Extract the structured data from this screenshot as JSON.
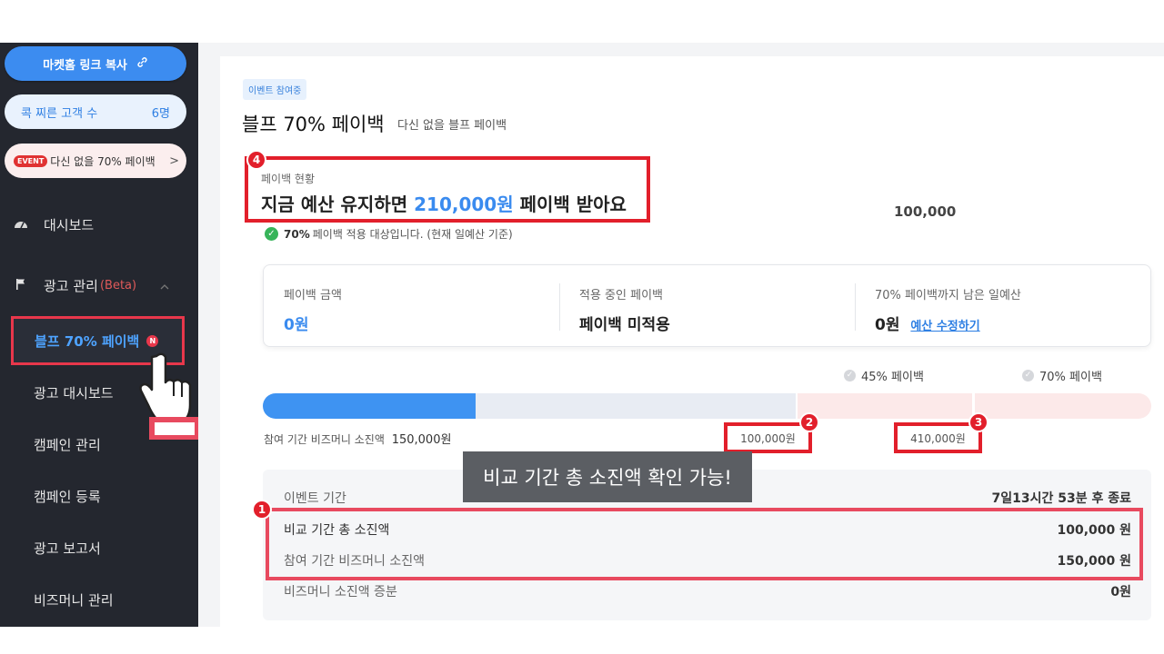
{
  "sidebar": {
    "copy_link_label": "마켓홈 링크 복사",
    "customer_count_label": "콕 찌른 고객 수",
    "customer_count_value": "6명",
    "event_badge": "EVENT",
    "event_label": "다신 없을 70% 페이백",
    "event_chevron": ">",
    "nav_dashboard": "대시보드",
    "nav_ads": "광고 관리",
    "nav_ads_beta": "(Beta)",
    "sub_active": "블프 70% 페이백",
    "sub_active_badge": "N",
    "sub_items": [
      "광고 대시보드",
      "캠페인 관리",
      "캠페인 등록",
      "광고 보고서",
      "비즈머니 관리"
    ]
  },
  "header": {
    "tag": "이벤트 참여중",
    "title": "블프 70% 페이백",
    "subtitle": "다신 없을 블프 페이백"
  },
  "status": {
    "label": "페이백 현황",
    "main_prefix": "지금 예산 유지하면",
    "main_amount": "210,000원",
    "main_suffix": "페이백 받아요",
    "note_bold": "70%",
    "note_rest": "페이백 적용 대상입니다. (현재 일예산 기준)",
    "right_value": "100,000"
  },
  "info": {
    "payback_amount_label": "페이백 금액",
    "payback_amount_value": "0원",
    "applied_label": "적용 중인 페이백",
    "applied_value": "페이백 미적용",
    "remaining_label": "70% 페이백까지 남은 일예산",
    "remaining_value": "0원",
    "edit_link": "예산 수정하기"
  },
  "progress": {
    "milestone_45": "45% 페이백",
    "milestone_70": "70% 페이백",
    "caption_label": "참여 기간 비즈머니 소진액",
    "caption_value": "150,000원",
    "marker_1": "100,000원",
    "marker_2": "410,000원",
    "fill_value": 150000
  },
  "tooltip": "비교 기간 총 소진액 확인 가능!",
  "details": {
    "period_label": "이벤트 기간",
    "period_value": "7일13시간 53분 후 종료",
    "compare_label": "비교 기간 총 소진액",
    "compare_value": "100,000 원",
    "biz_label": "참여 기간 비즈머니 소진액",
    "biz_value": "150,000 원",
    "inc_label": "비즈머니 소진액 증분",
    "inc_value": "0원"
  },
  "badges": [
    "1",
    "2",
    "3",
    "4"
  ],
  "colors": {
    "accent": "#3e93f2",
    "highlight": "#e21f2b",
    "sidebar": "#24272f"
  }
}
